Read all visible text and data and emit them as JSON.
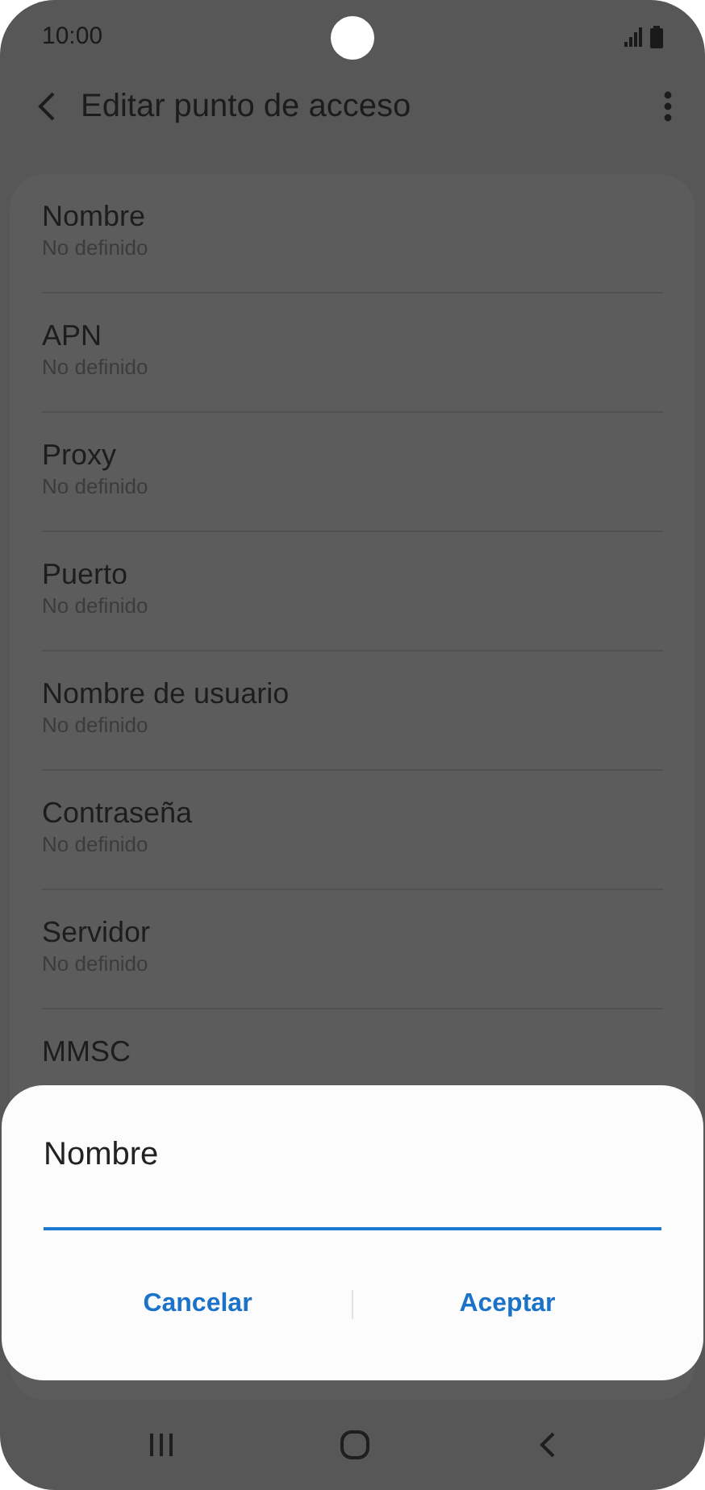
{
  "status_bar": {
    "time": "10:00"
  },
  "header": {
    "title": "Editar punto de acceso"
  },
  "settings": [
    {
      "title": "Nombre",
      "value": "No definido"
    },
    {
      "title": "APN",
      "value": "No definido"
    },
    {
      "title": "Proxy",
      "value": "No definido"
    },
    {
      "title": "Puerto",
      "value": "No definido"
    },
    {
      "title": "Nombre de usuario",
      "value": "No definido"
    },
    {
      "title": "Contraseña",
      "value": "No definido"
    },
    {
      "title": "Servidor",
      "value": "No definido"
    },
    {
      "title": "MMSC"
    }
  ],
  "dialog": {
    "title": "Nombre",
    "buttons": [
      "Cancelar",
      "Aceptar"
    ]
  }
}
